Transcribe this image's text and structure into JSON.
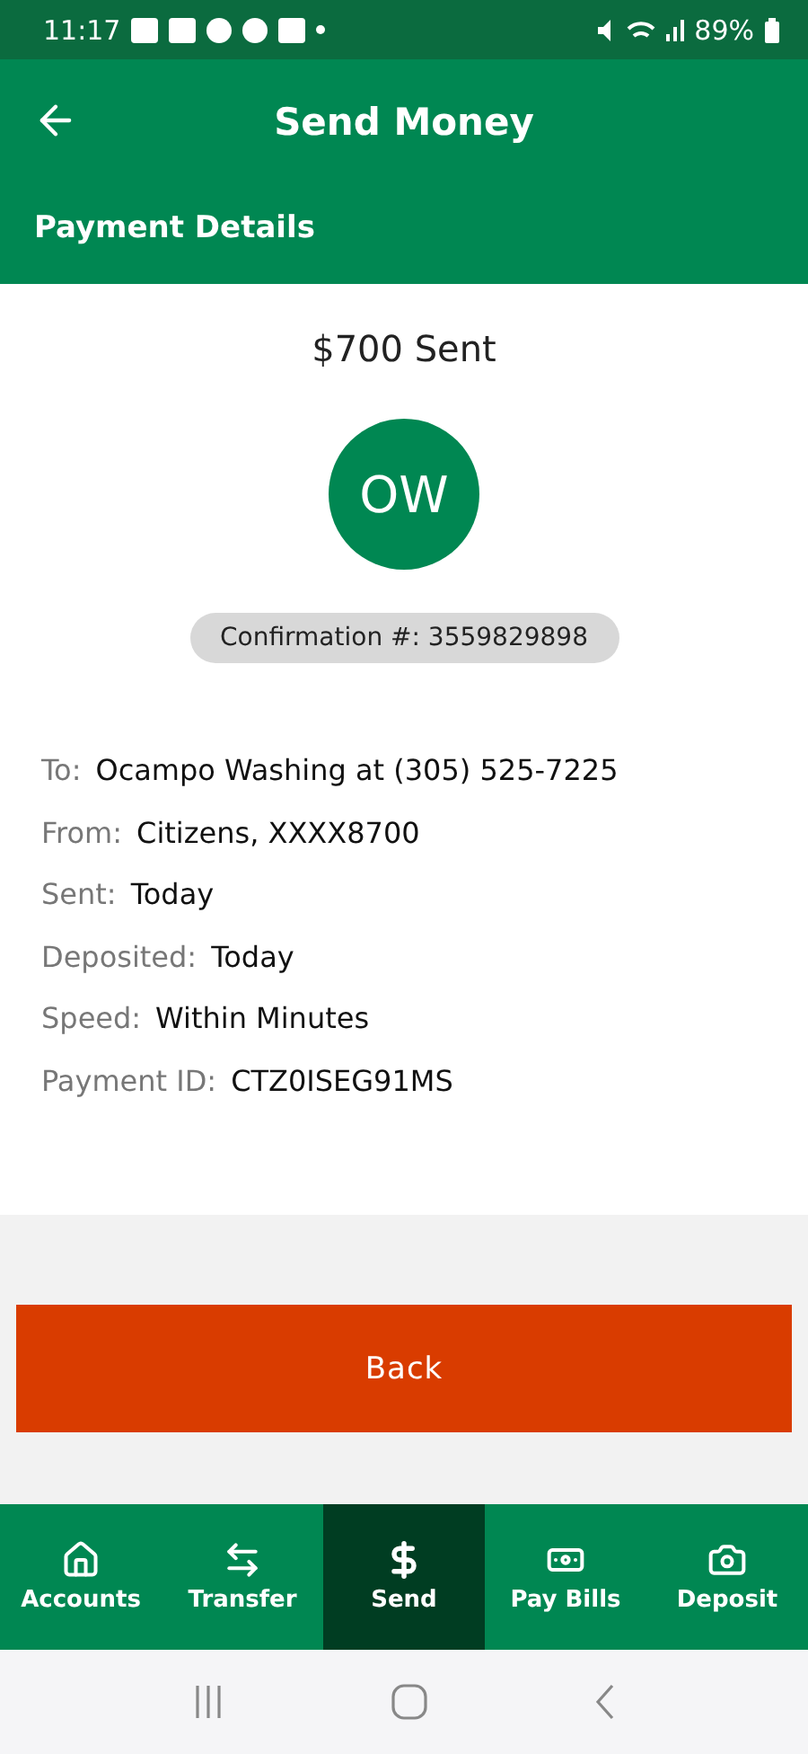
{
  "status_bar": {
    "time": "11:17",
    "battery": "89%"
  },
  "header": {
    "title": "Send Money",
    "subtitle": "Payment Details"
  },
  "summary": {
    "amount": "$700 Sent",
    "initials": "OW",
    "confirmation": "Confirmation #: 3559829898"
  },
  "details": [
    {
      "label": "To:",
      "value": "Ocampo Washing at (305) 525-7225"
    },
    {
      "label": "From:",
      "value": "Citizens, XXXX8700"
    },
    {
      "label": "Sent:",
      "value": "Today"
    },
    {
      "label": "Deposited:",
      "value": "Today"
    },
    {
      "label": "Speed:",
      "value": "Within Minutes"
    },
    {
      "label": "Payment ID:",
      "value": "CTZ0ISEG91MS"
    }
  ],
  "back_button": "Back",
  "nav": [
    {
      "label": "Accounts",
      "selected": false
    },
    {
      "label": "Transfer",
      "selected": false
    },
    {
      "label": "Send",
      "selected": true
    },
    {
      "label": "Pay Bills",
      "selected": false
    },
    {
      "label": "Deposit",
      "selected": false
    }
  ]
}
